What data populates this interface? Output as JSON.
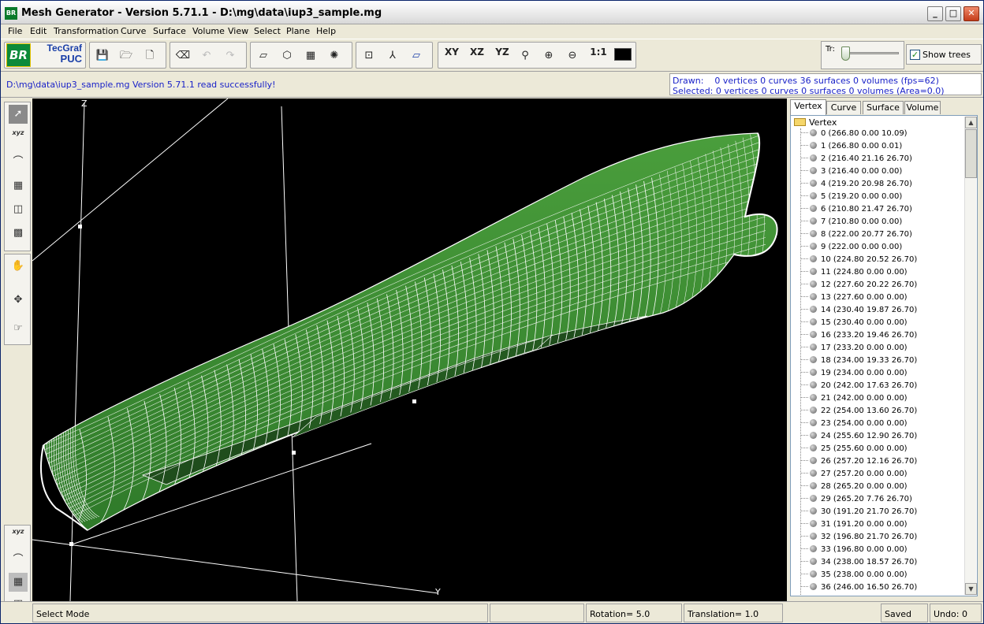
{
  "window": {
    "title": "Mesh Generator - Version 5.71.1 - D:\\mg\\data\\iup3_sample.mg",
    "app_icon_text": "BR"
  },
  "menu": [
    "File",
    "Edit",
    "Transformation",
    "Curve",
    "Surface",
    "Volume",
    "View",
    "Select",
    "Plane",
    "Help"
  ],
  "logo": {
    "br": "BR",
    "tecgraf_line1": "TecGraf",
    "tecgraf_line2": "PUC"
  },
  "toolbar": {
    "view_xy": "XY",
    "view_xz": "XZ",
    "view_yz": "YZ",
    "zoom_one": "1:1",
    "transparency_label": "Tr:",
    "transparency_level": 0.0,
    "show_trees_label": "Show trees",
    "show_trees_checked": true
  },
  "messages": {
    "status": "D:\\mg\\data\\iup3_sample.mg Version 5.71.1 read successfully!",
    "drawn": "Drawn:    0 vertices 0 curves 36 surfaces 0 volumes (fps=62)",
    "selected": "Selected: 0 vertices 0 curves 0 surfaces 0 volumes (Area=0.0)"
  },
  "viewport": {
    "axis_z": "Z",
    "axis_y": "Y",
    "hull_color": "#3d8f35",
    "mesh_color": "#ffffff"
  },
  "tabs": [
    "Vertex",
    "Curve",
    "Surface",
    "Volume"
  ],
  "active_tab": "Vertex",
  "tree": {
    "root": "Vertex",
    "items": [
      "0 (266.80 0.00 10.09)",
      "1 (266.80 0.00 0.01)",
      "2 (216.40 21.16 26.70)",
      "3 (216.40 0.00 0.00)",
      "4 (219.20 20.98 26.70)",
      "5 (219.20 0.00 0.00)",
      "6 (210.80 21.47 26.70)",
      "7 (210.80 0.00 0.00)",
      "8 (222.00 20.77 26.70)",
      "9 (222.00 0.00 0.00)",
      "10 (224.80 20.52 26.70)",
      "11 (224.80 0.00 0.00)",
      "12 (227.60 20.22 26.70)",
      "13 (227.60 0.00 0.00)",
      "14 (230.40 19.87 26.70)",
      "15 (230.40 0.00 0.00)",
      "16 (233.20 19.46 26.70)",
      "17 (233.20 0.00 0.00)",
      "18 (234.00 19.33 26.70)",
      "19 (234.00 0.00 0.00)",
      "20 (242.00 17.63 26.70)",
      "21 (242.00 0.00 0.00)",
      "22 (254.00 13.60 26.70)",
      "23 (254.00 0.00 0.00)",
      "24 (255.60 12.90 26.70)",
      "25 (255.60 0.00 0.00)",
      "26 (257.20 12.16 26.70)",
      "27 (257.20 0.00 0.00)",
      "28 (265.20 0.00 0.00)",
      "29 (265.20 7.76 26.70)",
      "30 (191.20 21.70 26.70)",
      "31 (191.20 0.00 0.00)",
      "32 (196.80 21.70 26.70)",
      "33 (196.80 0.00 0.00)",
      "34 (238.00 18.57 26.70)",
      "35 (238.00 0.00 0.00)",
      "36 (246.00 16.50 26.70)"
    ]
  },
  "statusbar": {
    "mode": "Select Mode",
    "rotation": "Rotation= 5.0",
    "translation": "Translation= 1.0",
    "saved": "Saved",
    "undo": "Undo: 0"
  }
}
